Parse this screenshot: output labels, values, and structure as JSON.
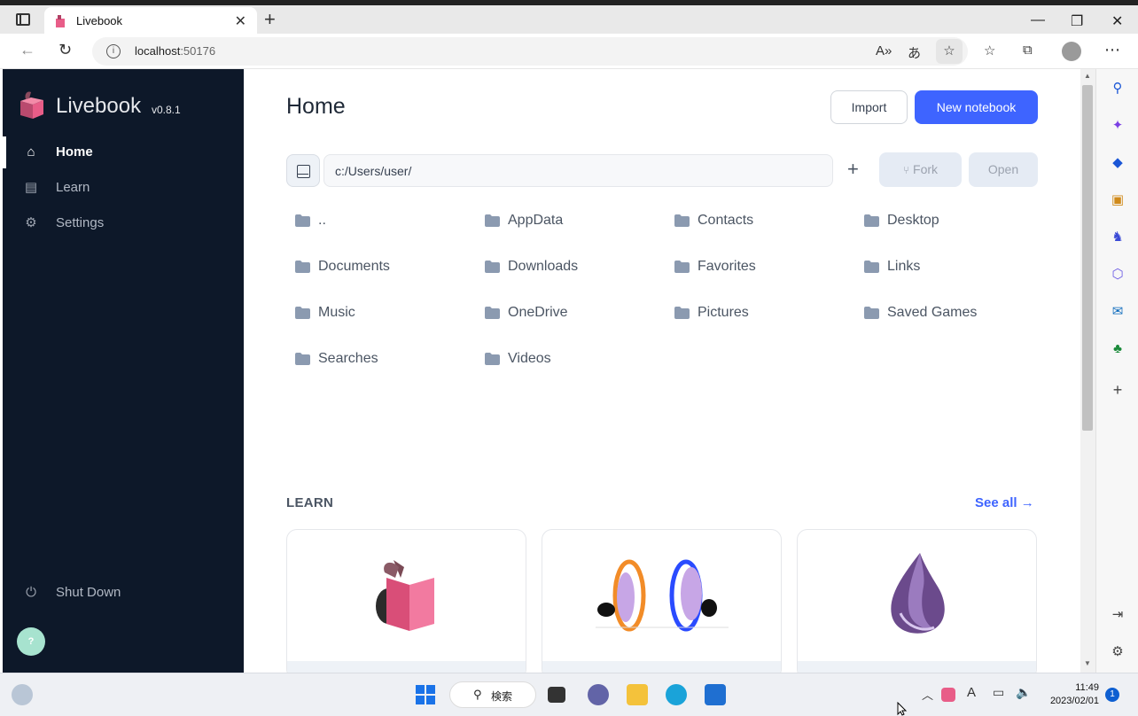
{
  "browser": {
    "tab_title": "Livebook",
    "url_host": "localhost",
    "url_port": ":50176"
  },
  "sidebar": {
    "app_name": "Livebook",
    "version": "v0.8.1",
    "items": [
      {
        "label": "Home",
        "icon": "home-icon"
      },
      {
        "label": "Learn",
        "icon": "book-icon"
      },
      {
        "label": "Settings",
        "icon": "gear-icon"
      }
    ],
    "shutdown_label": "Shut Down",
    "help_label": "?"
  },
  "main": {
    "title": "Home",
    "import_label": "Import",
    "new_notebook_label": "New notebook",
    "path_value": "c:/Users/user/",
    "fork_label": "Fork",
    "open_label": "Open",
    "folders": [
      "..",
      "AppData",
      "Contacts",
      "Desktop",
      "Documents",
      "Downloads",
      "Favorites",
      "Links",
      "Music",
      "OneDrive",
      "Pictures",
      "Saved Games",
      "Searches",
      "Videos"
    ],
    "learn_heading": "LEARN",
    "see_all_label": "See all"
  },
  "taskbar": {
    "search_label": "検索",
    "time": "11:49",
    "date": "2023/02/01",
    "notification_count": "1"
  },
  "colors": {
    "sidebar_bg": "#0d1829",
    "accent": "#3e64ff",
    "folder": "#8b9ab0"
  }
}
